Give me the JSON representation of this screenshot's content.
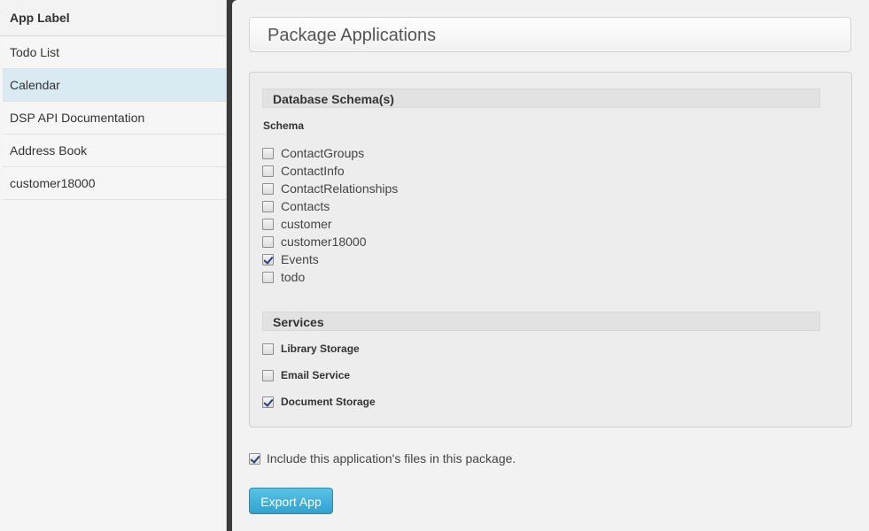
{
  "sidebar": {
    "header": "App Label",
    "items": [
      {
        "label": "Todo List",
        "active": false
      },
      {
        "label": "Calendar",
        "active": true
      },
      {
        "label": "DSP API Documentation",
        "active": false
      },
      {
        "label": "Address Book",
        "active": false
      },
      {
        "label": "customer18000",
        "active": false
      }
    ]
  },
  "main": {
    "title": "Package Applications",
    "database_section": {
      "heading": "Database Schema(s)",
      "subheading": "Schema",
      "schemas": [
        {
          "label": "ContactGroups",
          "checked": false
        },
        {
          "label": "ContactInfo",
          "checked": false
        },
        {
          "label": "ContactRelationships",
          "checked": false
        },
        {
          "label": "Contacts",
          "checked": false
        },
        {
          "label": "customer",
          "checked": false
        },
        {
          "label": "customer18000",
          "checked": false
        },
        {
          "label": "Events",
          "checked": true
        },
        {
          "label": "todo",
          "checked": false
        }
      ]
    },
    "services_section": {
      "heading": "Services",
      "services": [
        {
          "label": "Library Storage",
          "checked": false
        },
        {
          "label": "Email Service",
          "checked": false
        },
        {
          "label": "Document Storage",
          "checked": true
        }
      ]
    },
    "include_files": {
      "label": "Include this application's files in this package.",
      "checked": true
    },
    "export_button": "Export App"
  },
  "colors": {
    "active_item_bg": "#d9eaf3",
    "button_bg": "#3aaad4"
  }
}
